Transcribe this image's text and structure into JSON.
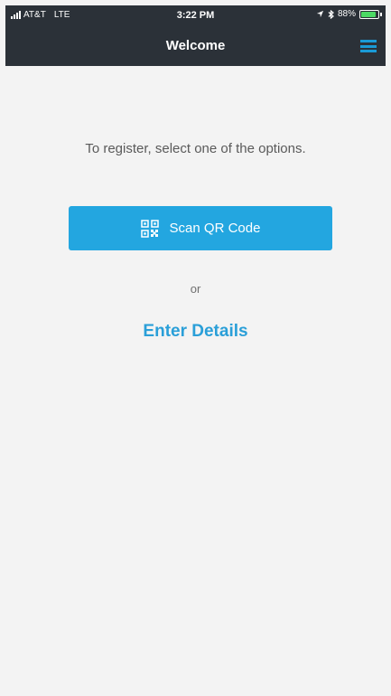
{
  "status_bar": {
    "carrier": "AT&T",
    "network": "LTE",
    "time": "3:22 PM",
    "battery_text": "88%",
    "battery_level": 0.88,
    "battery_color": "#4cd964"
  },
  "nav": {
    "title": "Welcome",
    "menu_icon": "hamburger-menu-icon"
  },
  "main": {
    "intro_text": "To register, select one of the options.",
    "scan_button_label": "Scan QR Code",
    "scan_button_icon": "qr-code-icon",
    "or_text": "or",
    "enter_details_label": "Enter Details"
  },
  "colors": {
    "nav_background": "#2b3138",
    "accent": "#23a6e0",
    "link": "#2a9fd8",
    "page_background": "#f3f3f3"
  }
}
